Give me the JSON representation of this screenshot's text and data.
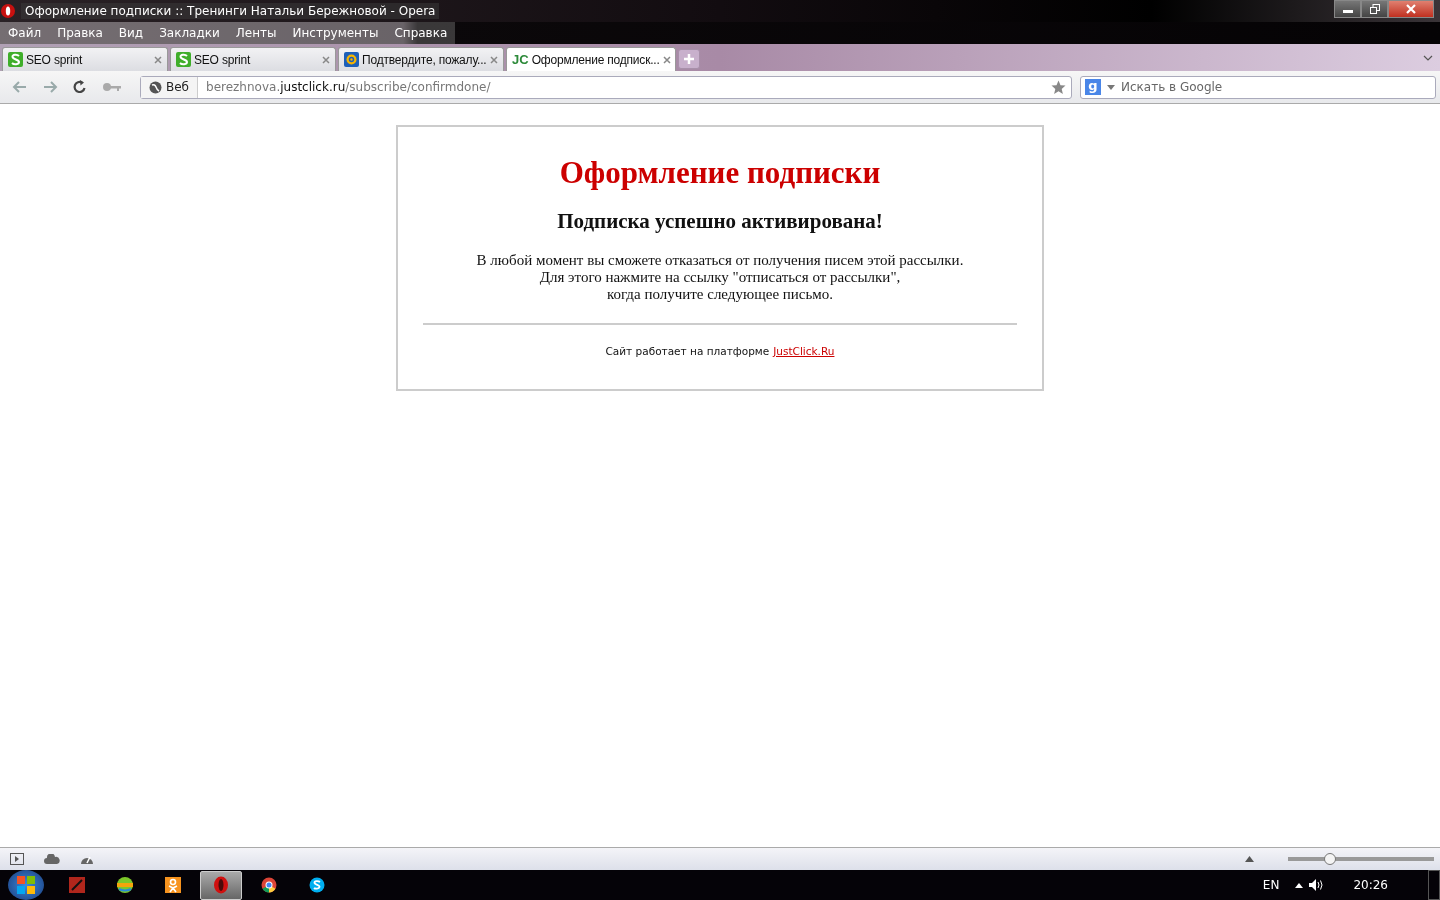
{
  "window": {
    "title": "Оформление подписки :: Тренинги Натальи Бережновой - Opera"
  },
  "menu": [
    "Файл",
    "Правка",
    "Вид",
    "Закладки",
    "Ленты",
    "Инструменты",
    "Справка"
  ],
  "tabs": [
    {
      "label": "SEO sprint",
      "kind": "seo",
      "selected": false
    },
    {
      "label": "SEO sprint",
      "kind": "seo",
      "selected": false
    },
    {
      "label": "Подтвердите, пожалу...",
      "kind": "mail",
      "selected": false
    },
    {
      "label": "Оформление подписк...",
      "kind": "text",
      "icon_text": "JC",
      "selected": true
    }
  ],
  "address": {
    "badge": "Веб",
    "subdomain": "berezhnova.",
    "domain": "justclick.ru",
    "path": "/subscribe/confirmdone/"
  },
  "search": {
    "engine_badge": "g",
    "placeholder": "Искать в Google"
  },
  "page": {
    "title": "Оформление подписки",
    "subtitle": "Подписка успешно активирована!",
    "lines": [
      "В любой момент вы сможете отказаться от получения писем этой рассылки.",
      "Для этого нажмите на ссылку \"отписаться от рассылки\",",
      "когда получите следующее письмо."
    ],
    "footer_text": "Сайт работает на платформе",
    "footer_link": "JustClick.Ru"
  },
  "status_bar": {
    "zoom": {
      "level": 0.27
    }
  },
  "taskbar": {
    "apps": [
      {
        "selected": false
      },
      {
        "selected": false
      },
      {
        "selected": false
      },
      {
        "selected": true
      },
      {
        "selected": false
      },
      {
        "selected": false
      }
    ],
    "language": "EN",
    "clock": "20:26"
  }
}
